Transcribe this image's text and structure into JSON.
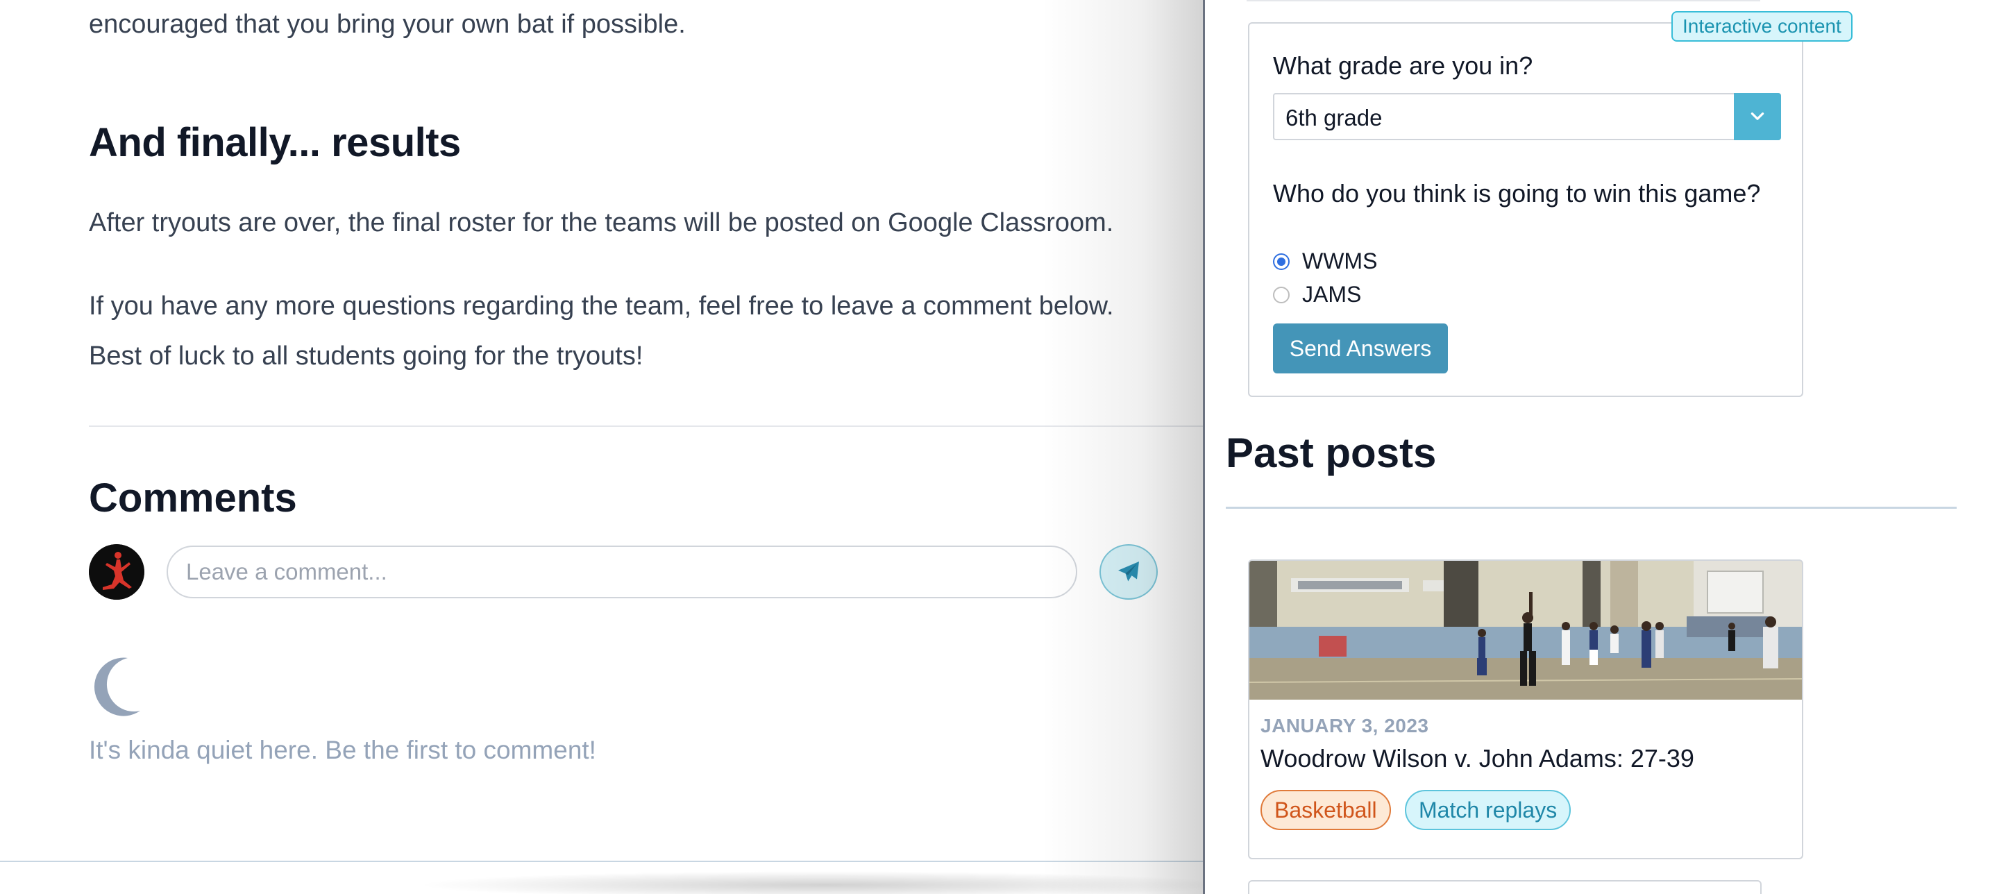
{
  "article": {
    "bat_sentence": "encouraged that you bring your own bat if possible.",
    "results_heading": "And finally... results",
    "roster_sentence": "After tryouts are over, the final roster for the teams will be posted on Google Classroom.",
    "questions_sentence": "If you have any more questions regarding the team, feel free to leave a comment below.",
    "luck_sentence": "Best of luck to all students going for the tryouts!"
  },
  "comments": {
    "heading": "Comments",
    "input_placeholder": "Leave a comment...",
    "input_value": "",
    "empty_message": "It's kinda quiet here. Be the first to comment!"
  },
  "quiz": {
    "badge": "Interactive content",
    "question_grade": "What grade are you in?",
    "grade_selected": "6th grade",
    "question_winner": "Who do you think is going to win this game?",
    "options": [
      {
        "label": "WWMS",
        "checked": true
      },
      {
        "label": "JAMS",
        "checked": false
      }
    ],
    "submit_label": "Send Answers"
  },
  "past_posts": {
    "heading": "Past posts",
    "posts": [
      {
        "date": "JANUARY 3, 2023",
        "title": "Woodrow Wilson v. John Adams: 27-39",
        "tags": [
          "Basketball",
          "Match replays"
        ]
      }
    ]
  },
  "colors": {
    "accent_teal": "#4eb4d3",
    "button_blue": "#4495b8",
    "radio_blue": "#2f6fe0",
    "tag_orange": "#d0551b",
    "tag_teal": "#1f87a8",
    "muted_text": "#94a3b8"
  },
  "icons": {
    "send": "paper-plane-icon",
    "empty_state": "moon-icon",
    "select_toggle": "chevron-down-icon",
    "avatar": "jumpman-logo-icon"
  }
}
